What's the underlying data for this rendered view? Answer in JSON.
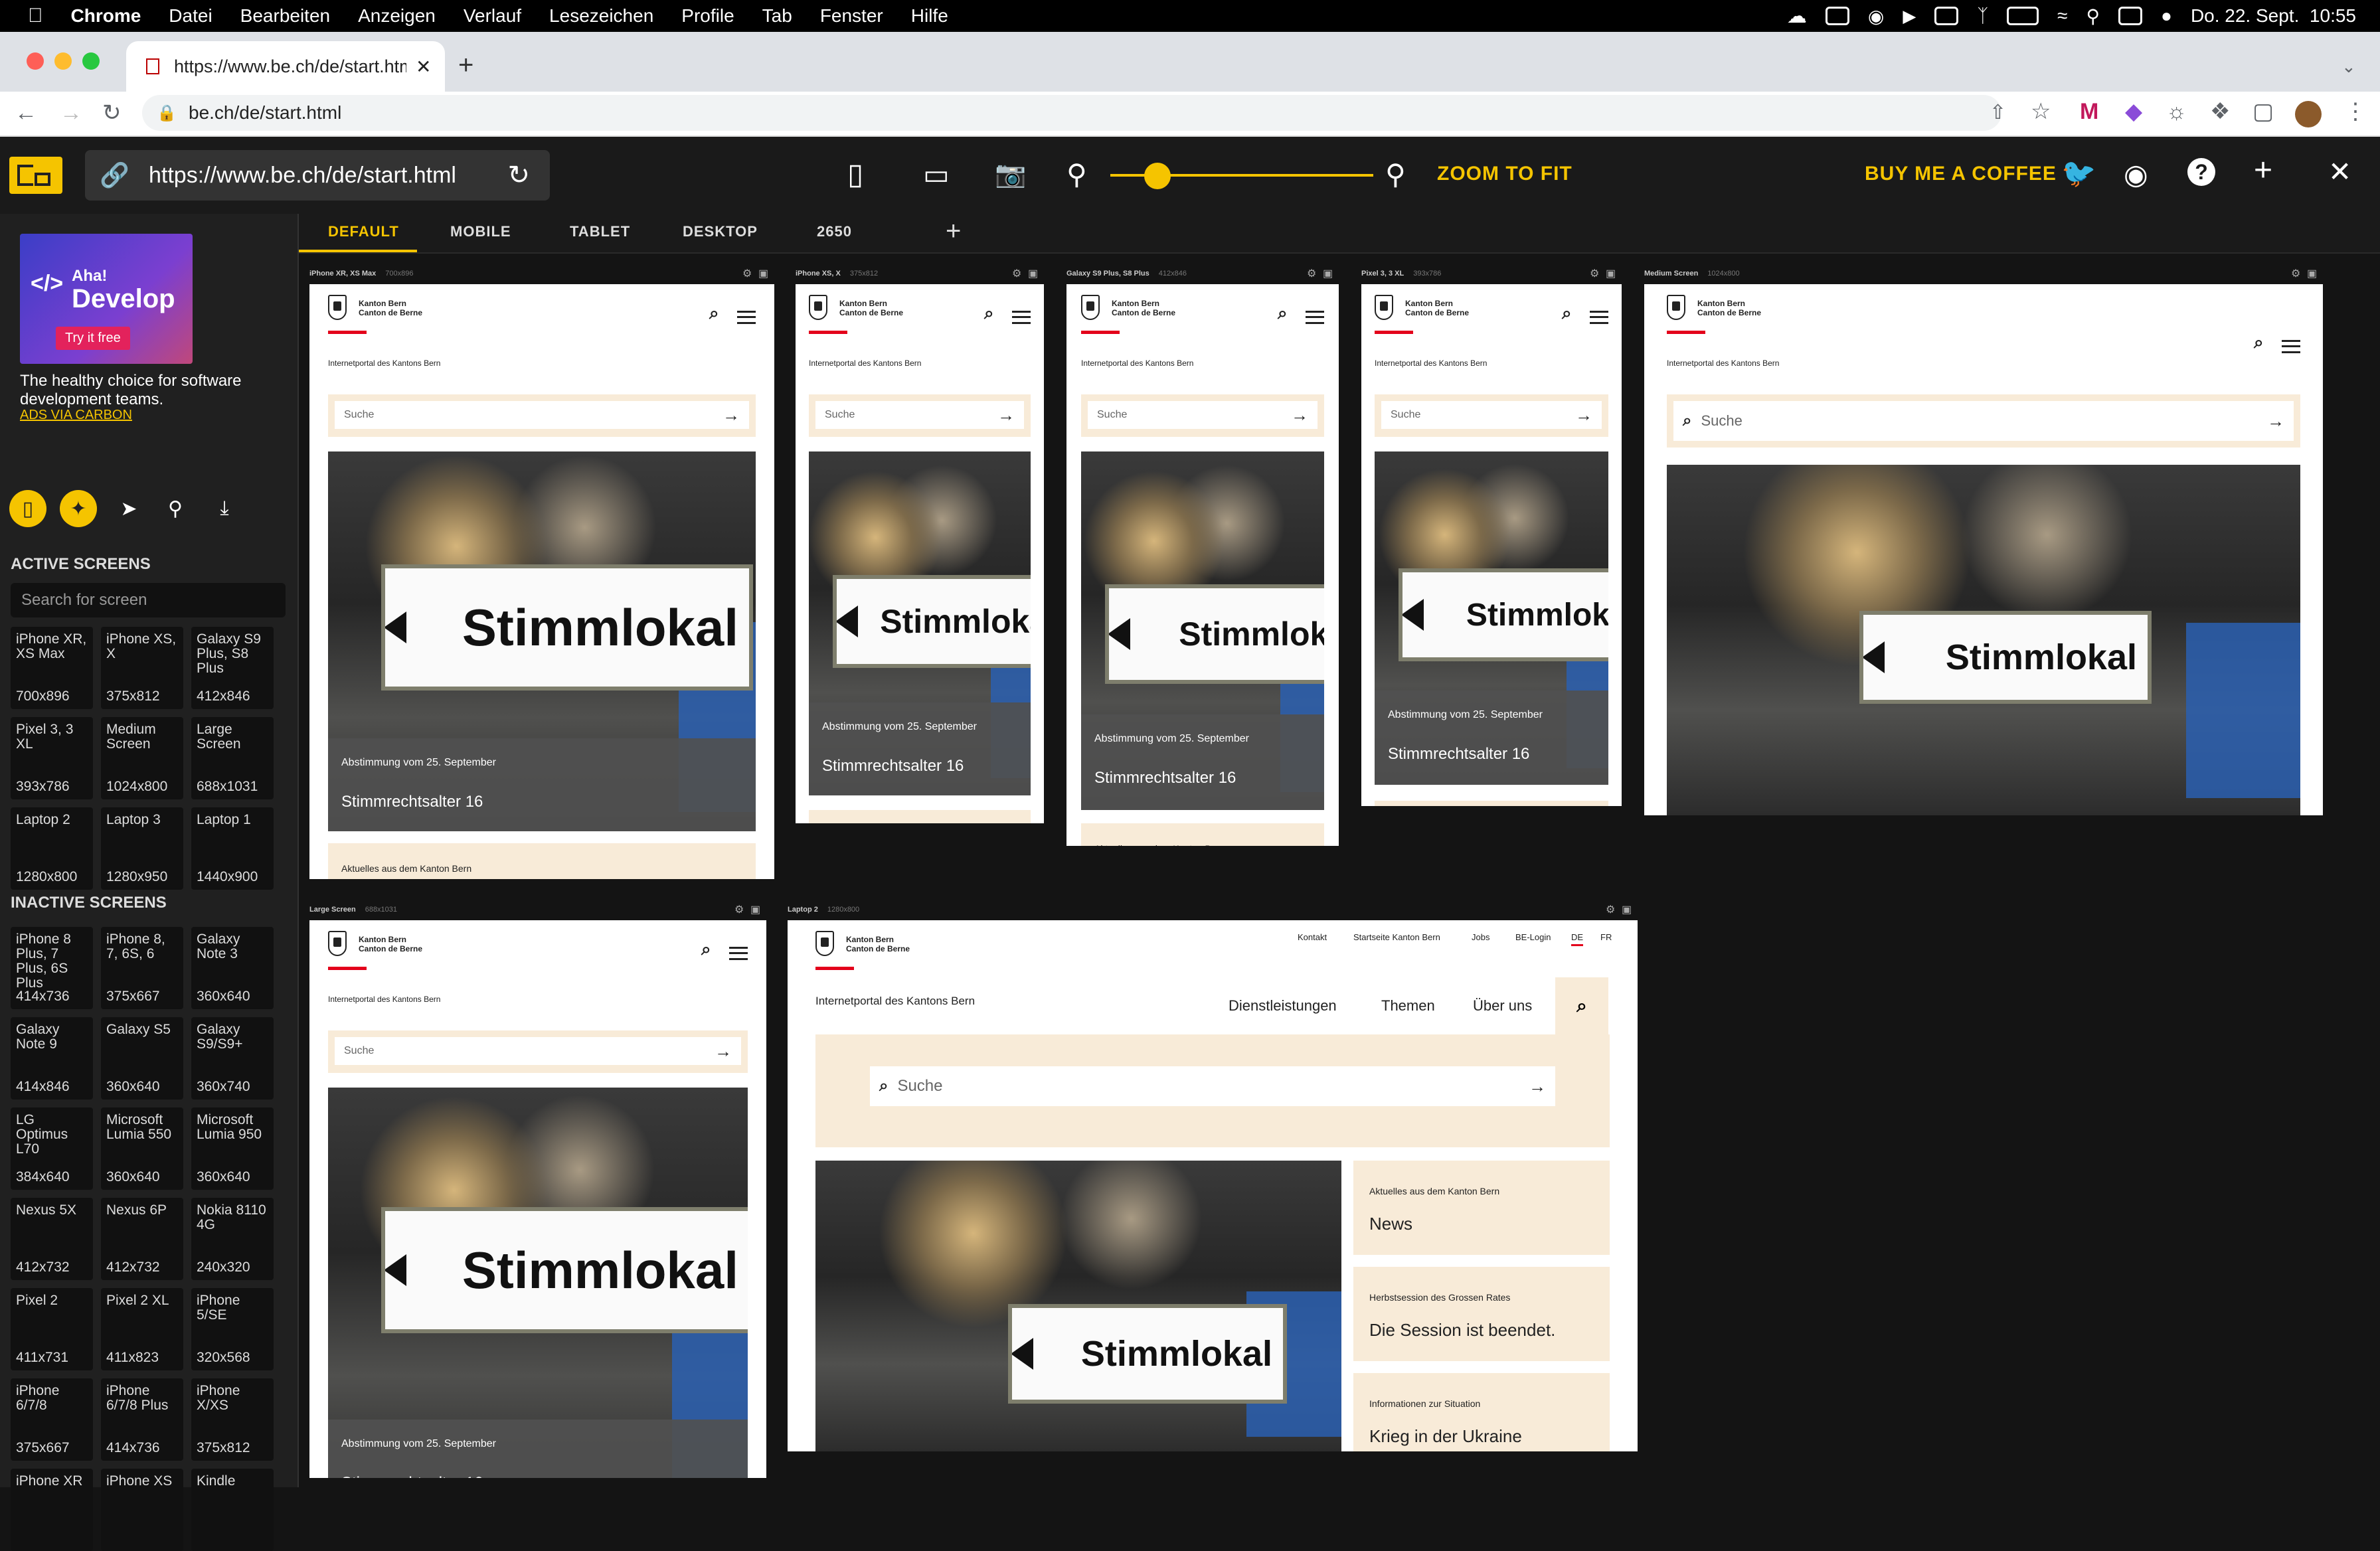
{
  "menubar": {
    "app": "Chrome",
    "items": [
      "Datei",
      "Bearbeiten",
      "Anzeigen",
      "Verlauf",
      "Lesezeichen",
      "Profile",
      "Tab",
      "Fenster",
      "Hilfe"
    ],
    "datetime": "Do. 22. Sept.  10:55"
  },
  "browser": {
    "tab_title": "https://www.be.ch/de/start.htm",
    "omnibox": "be.ch/de/start.html"
  },
  "viewer": {
    "url": "https://www.be.ch/de/start.html",
    "zoom_fit": "ZOOM TO FIT",
    "coffee": "BUY ME A COFFEE",
    "zoom_level": 0.18,
    "view_tabs": [
      "DEFAULT",
      "MOBILE",
      "TABLET",
      "DESKTOP",
      "2650"
    ],
    "active_tab": "DEFAULT"
  },
  "sidebar": {
    "ad_brand": "Aha!",
    "ad_title": "Develop",
    "ad_cta": "Try it free",
    "ad_text": "The healthy choice for software development teams.",
    "ad_link": "ADS VIA CARBON",
    "active_heading": "ACTIVE SCREENS",
    "search_placeholder": "Search for screen",
    "inactive_heading": "INACTIVE SCREENS",
    "active_screens": [
      {
        "name": "iPhone XR, XS Max",
        "dim": "700x896"
      },
      {
        "name": "iPhone XS, X",
        "dim": "375x812"
      },
      {
        "name": "Galaxy S9 Plus, S8 Plus",
        "dim": "412x846"
      },
      {
        "name": "Pixel 3, 3 XL",
        "dim": "393x786"
      },
      {
        "name": "Medium Screen",
        "dim": "1024x800"
      },
      {
        "name": "Large Screen",
        "dim": "688x1031"
      },
      {
        "name": "Laptop 2",
        "dim": "1280x800"
      },
      {
        "name": "Laptop 3",
        "dim": "1280x950"
      },
      {
        "name": "Laptop 1",
        "dim": "1440x900"
      }
    ],
    "inactive_screens": [
      {
        "name": "iPhone 8 Plus, 7 Plus, 6S Plus",
        "dim": "414x736"
      },
      {
        "name": "iPhone 8, 7, 6S, 6",
        "dim": "375x667"
      },
      {
        "name": "Galaxy Note 3",
        "dim": "360x640"
      },
      {
        "name": "Galaxy Note 9",
        "dim": "414x846"
      },
      {
        "name": "Galaxy S5",
        "dim": "360x640"
      },
      {
        "name": "Galaxy S9/S9+",
        "dim": "360x740"
      },
      {
        "name": "LG Optimus L70",
        "dim": "384x640"
      },
      {
        "name": "Microsoft Lumia 550",
        "dim": "360x640"
      },
      {
        "name": "Microsoft Lumia 950",
        "dim": "360x640"
      },
      {
        "name": "Nexus 5X",
        "dim": "412x732"
      },
      {
        "name": "Nexus 6P",
        "dim": "412x732"
      },
      {
        "name": "Nokia 8110 4G",
        "dim": "240x320"
      },
      {
        "name": "Pixel 2",
        "dim": "411x731"
      },
      {
        "name": "Pixel 2 XL",
        "dim": "411x823"
      },
      {
        "name": "iPhone 5/SE",
        "dim": "320x568"
      },
      {
        "name": "iPhone 6/7/8",
        "dim": "375x667"
      },
      {
        "name": "iPhone 6/7/8 Plus",
        "dim": "414x736"
      },
      {
        "name": "iPhone X/XS",
        "dim": "375x812"
      },
      {
        "name": "iPhone XR",
        "dim": ""
      },
      {
        "name": "iPhone XS",
        "dim": ""
      },
      {
        "name": "Kindle",
        "dim": ""
      }
    ]
  },
  "site": {
    "canton_de": "Kanton Bern",
    "canton_fr": "Canton de Berne",
    "portal": "Internetportal des Kantons Bern",
    "search": "Suche",
    "sign": "Stimmlokal",
    "teaser_small": "Abstimmung vom 25. September",
    "teaser_big": "Stimmrechtsalter 16",
    "news_small": "Aktuelles aus dem Kanton Bern",
    "top_links": [
      "Kontakt",
      "Startseite Kanton Bern",
      "Jobs",
      "BE-Login",
      "DE",
      "FR"
    ],
    "nav": [
      "Dienstleistungen",
      "Themen",
      "Über uns"
    ],
    "cards": [
      {
        "small": "Aktuelles aus dem Kanton Bern",
        "big": "News"
      },
      {
        "small": "Herbstsession des Grossen Rates",
        "big": "Die Session ist beendet."
      },
      {
        "small": "Informationen zur Situation",
        "big": "Krieg in der Ukraine"
      }
    ]
  },
  "frames": {
    "f1": {
      "name": "iPhone XR, XS Max",
      "dim": "700x896"
    },
    "f2": {
      "name": "iPhone XS, X",
      "dim": "375x812"
    },
    "f3": {
      "name": "Galaxy S9 Plus, S8 Plus",
      "dim": "412x846"
    },
    "f4": {
      "name": "Pixel 3, 3 XL",
      "dim": "393x786"
    },
    "f5": {
      "name": "Medium Screen",
      "dim": "1024x800"
    },
    "f6": {
      "name": "Large Screen",
      "dim": "688x1031"
    },
    "f7": {
      "name": "Laptop 2",
      "dim": "1280x800"
    }
  }
}
